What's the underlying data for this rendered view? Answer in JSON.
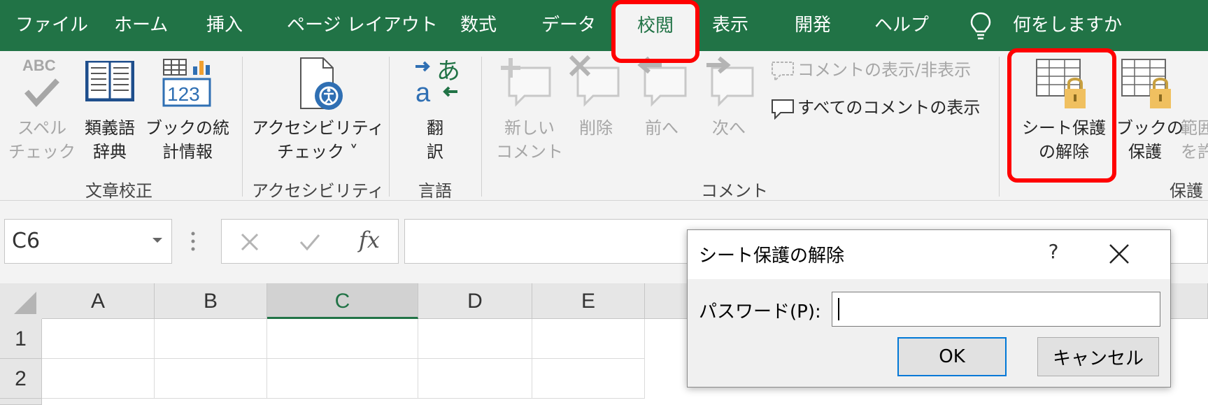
{
  "menu": {
    "items": [
      "ファイル",
      "ホーム",
      "挿入",
      "ページ レイアウト",
      "数式",
      "データ",
      "校閲",
      "表示",
      "開発",
      "ヘルプ"
    ],
    "active_index": 6,
    "tell_me": "何をしますか"
  },
  "ribbon": {
    "proofing": {
      "spell_line1": "スペル",
      "spell_line2": "チェック",
      "spell_icon_text": "ABC",
      "thesaurus_line1": "類義語",
      "thesaurus_line2": "辞典",
      "stats_line1": "ブックの統",
      "stats_line2": "計情報",
      "stats_icon_text": "123",
      "group": "文章校正"
    },
    "accessibility": {
      "check_line1": "アクセシビリティ",
      "check_line2": "チェック ˅",
      "group": "アクセシビリティ"
    },
    "language": {
      "translate_line1": "翻",
      "translate_line2": "訳",
      "group": "言語"
    },
    "comments": {
      "new_line1": "新しい",
      "new_line2": "コメント",
      "delete": "削除",
      "prev": "前へ",
      "next": "次へ",
      "show_hide": "コメントの表示/非表示",
      "show_all": "すべてのコメントの表示",
      "group": "コメント"
    },
    "protect": {
      "unprotect_line1": "シート保護",
      "unprotect_line2": "の解除",
      "book_line1": "ブックの",
      "book_line2": "保護",
      "range_line1": "範囲",
      "range_line2": "を許",
      "group": "保護"
    }
  },
  "formula_bar": {
    "name_box": "C6",
    "fx": "fx"
  },
  "grid": {
    "columns": [
      "A",
      "B",
      "C",
      "D",
      "E"
    ],
    "selected_column": "C",
    "rows": [
      "1",
      "2"
    ]
  },
  "dialog": {
    "title": "シート保護の解除",
    "help": "?",
    "password_label": "パスワード(P):",
    "password_value": "",
    "ok": "OK",
    "cancel": "キャンセル"
  },
  "colors": {
    "excel_green": "#217346",
    "highlight_red": "#ff0000",
    "focus_blue": "#0078d7",
    "lock_gold": "#f0c060"
  }
}
